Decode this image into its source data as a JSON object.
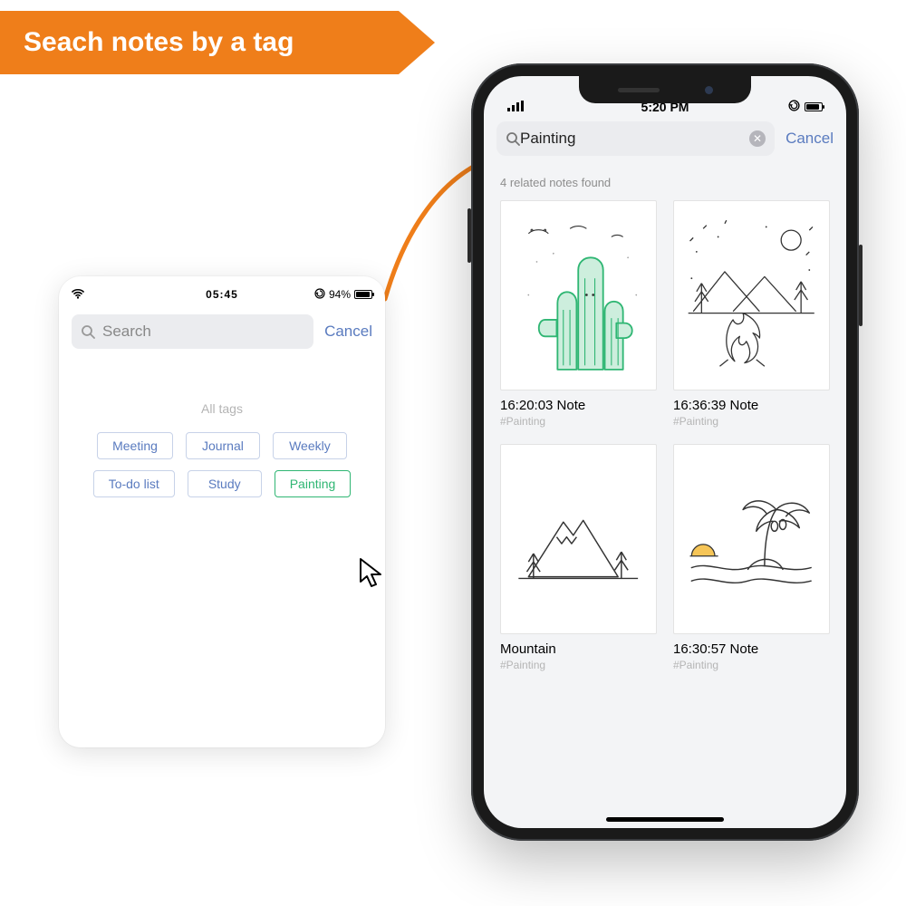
{
  "banner": {
    "title": "Seach notes by a tag"
  },
  "tablet": {
    "status": {
      "time": "05:45",
      "battery_pct": "94%"
    },
    "search": {
      "placeholder": "Search",
      "cancel_label": "Cancel"
    },
    "alltags_label": "All tags",
    "tags": [
      {
        "label": "Meeting",
        "selected": false
      },
      {
        "label": "Journal",
        "selected": false
      },
      {
        "label": "Weekly",
        "selected": false
      },
      {
        "label": "To-do list",
        "selected": false
      },
      {
        "label": "Study",
        "selected": false
      },
      {
        "label": "Painting",
        "selected": true
      }
    ]
  },
  "phone": {
    "status": {
      "time": "5:20 PM"
    },
    "search": {
      "query": "Painting",
      "cancel_label": "Cancel"
    },
    "found_label": "4 related notes found",
    "notes": [
      {
        "title": "16:20:03 Note",
        "tag": "#Painting",
        "art": "cactus"
      },
      {
        "title": "16:36:39 Note",
        "tag": "#Painting",
        "art": "camp"
      },
      {
        "title": "Mountain",
        "tag": "#Painting",
        "art": "mountain"
      },
      {
        "title": "16:30:57 Note",
        "tag": "#Painting",
        "art": "island"
      }
    ]
  }
}
